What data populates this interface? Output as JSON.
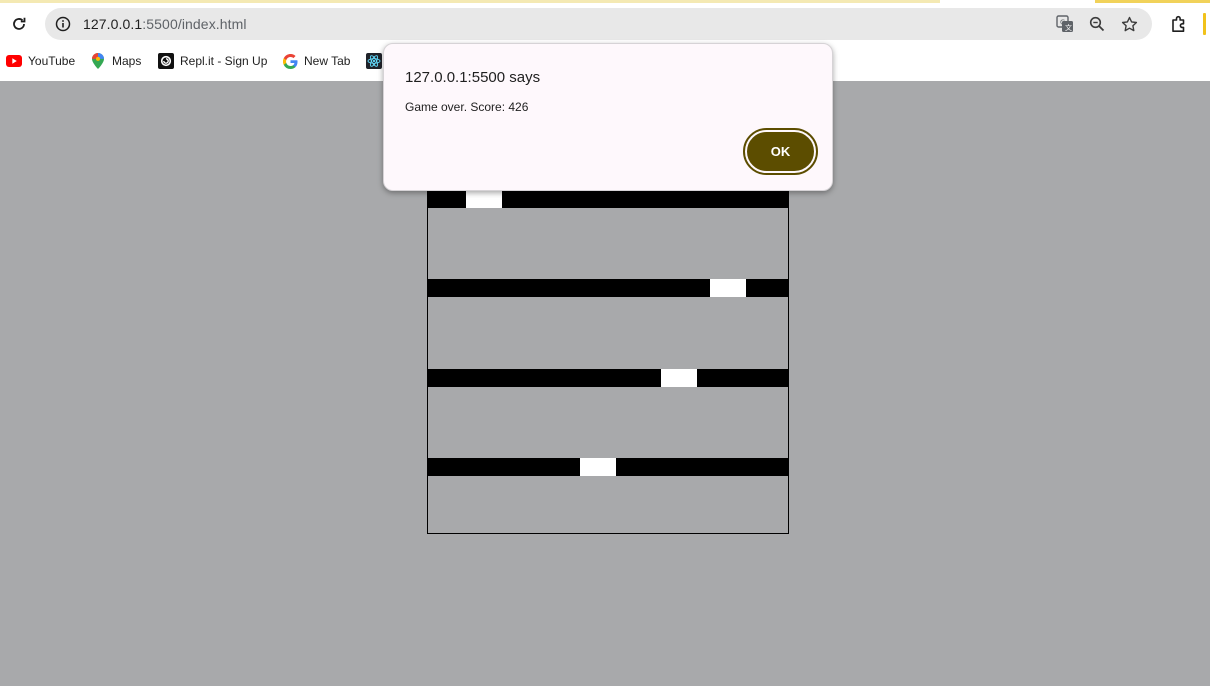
{
  "browser": {
    "url_host": "127.0.0.1",
    "url_rest": ":5500/index.html",
    "bookmarks": [
      {
        "label": "YouTube",
        "icon": "youtube-icon"
      },
      {
        "label": "Maps",
        "icon": "maps-icon"
      },
      {
        "label": "Repl.it - Sign Up",
        "icon": "replit-icon"
      },
      {
        "label": "New Tab",
        "icon": "google-icon"
      },
      {
        "label": "",
        "icon": "react-icon"
      }
    ]
  },
  "dialog": {
    "title": "127.0.0.1:5500 says",
    "message": "Game over. Score: 426",
    "ok_label": "OK"
  },
  "colors": {
    "page_background": "#a8a9ab",
    "wall": "#000000",
    "gap": "#ffffff",
    "ok_button": "#5c4d00"
  }
}
